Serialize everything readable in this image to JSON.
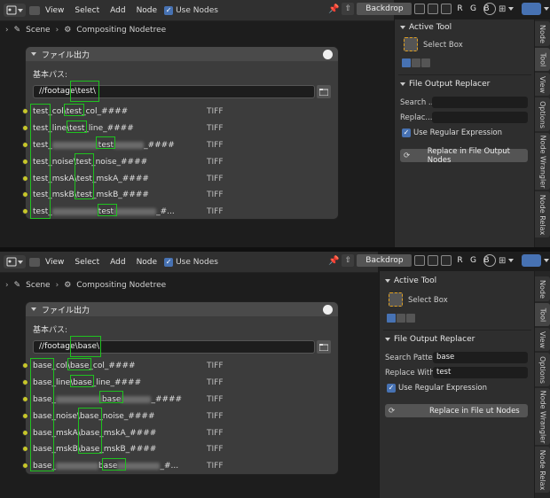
{
  "menu": {
    "view": "View",
    "select": "Select",
    "add": "Add",
    "node": "Node",
    "use_nodes": "Use Nodes"
  },
  "header": {
    "backdrop": "Backdrop",
    "channels": [
      "R",
      "G",
      "B"
    ]
  },
  "breadcrumb": {
    "scene": "Scene",
    "nodetree": "Compositing Nodetree"
  },
  "node": {
    "title": "ファイル出力",
    "base_path_label": "基本パス:",
    "format": "TIFF"
  },
  "top": {
    "base_path": "//footage\\test\\",
    "rows": [
      {
        "prefix": "test_col\\",
        "mid": "test",
        "suffix": "_col_####"
      },
      {
        "prefix": "test_line\\",
        "mid": "test",
        "suffix": "_line_####"
      },
      {
        "prefix": "test_",
        "mid": "test",
        "suffix": "_####"
      },
      {
        "prefix": "test_noise\\",
        "mid": "test",
        "suffix": "_noise_####"
      },
      {
        "prefix": "test_mskA\\",
        "mid": "test",
        "suffix": "_mskA_####"
      },
      {
        "prefix": "test_mskB\\",
        "mid": "test",
        "suffix": "_mskB_####"
      },
      {
        "prefix": "test_",
        "mid": "test",
        "suffix": "_#..."
      }
    ],
    "sidebar": {
      "active_tool": "Active Tool",
      "select_box": "Select Box",
      "replacer_title": "File Output Replacer",
      "search_label": "Search ...",
      "search_value": "",
      "replace_label": "Replac...",
      "replace_value": "",
      "regex_label": "Use Regular Expression",
      "replace_button": "Replace in File Output Nodes"
    }
  },
  "bottom": {
    "base_path": "//footage\\base\\",
    "rows": [
      {
        "prefix": "base_col\\",
        "mid": "base",
        "suffix": "_col_####"
      },
      {
        "prefix": "base_line\\",
        "mid": "base",
        "suffix": "_line_####"
      },
      {
        "prefix": "base_",
        "mid": "base",
        "suffix": "_####"
      },
      {
        "prefix": "base_noise\\",
        "mid": "base",
        "suffix": "_noise_####"
      },
      {
        "prefix": "base_mskA\\",
        "mid": "base",
        "suffix": "_mskA_####"
      },
      {
        "prefix": "base_mskB\\",
        "mid": "base",
        "suffix": "_mskB_####"
      },
      {
        "prefix": "base_",
        "mid": "base",
        "suffix": "_#..."
      }
    ],
    "sidebar": {
      "active_tool": "Active Tool",
      "select_box": "Select Box",
      "replacer_title": "File Output Replacer",
      "search_label": "Search Patte...",
      "search_value": "base",
      "replace_label": "Replace With:",
      "replace_value": "test",
      "regex_label": "Use Regular Expression",
      "replace_button": "Replace in File ut Nodes"
    }
  },
  "tabs": [
    "Node",
    "Tool",
    "View",
    "Options",
    "Node Wrangler",
    "Node Relax"
  ],
  "colors": {
    "accent": "#4772b3",
    "highlight": "#1fc21f",
    "socket": "#c7c729"
  }
}
